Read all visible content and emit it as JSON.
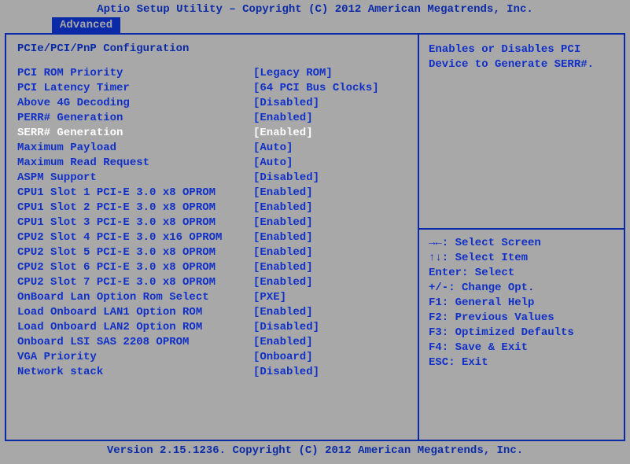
{
  "header": "Aptio Setup Utility – Copyright (C) 2012 American Megatrends, Inc.",
  "tab": "Advanced",
  "section_title": "PCIe/PCI/PnP Configuration",
  "settings": [
    {
      "label": "PCI ROM Priority",
      "value": "[Legacy ROM]",
      "selected": false
    },
    {
      "label": "PCI Latency Timer",
      "value": "[64 PCI Bus Clocks]",
      "selected": false
    },
    {
      "label": "Above 4G Decoding",
      "value": "[Disabled]",
      "selected": false
    },
    {
      "label": "PERR# Generation",
      "value": "[Enabled]",
      "selected": false
    },
    {
      "label": "SERR# Generation",
      "value": "[Enabled]",
      "selected": true
    },
    {
      "label": "Maximum Payload",
      "value": "[Auto]",
      "selected": false
    },
    {
      "label": "Maximum Read Request",
      "value": "[Auto]",
      "selected": false
    },
    {
      "label": "ASPM Support",
      "value": "[Disabled]",
      "selected": false
    },
    {
      "label": "CPU1 Slot 1 PCI-E 3.0 x8 OPROM",
      "value": "[Enabled]",
      "selected": false
    },
    {
      "label": "CPU1 Slot 2 PCI-E 3.0 x8 OPROM",
      "value": "[Enabled]",
      "selected": false
    },
    {
      "label": "CPU1 Slot 3 PCI-E 3.0 x8 OPROM",
      "value": "[Enabled]",
      "selected": false
    },
    {
      "label": "CPU2 Slot 4 PCI-E 3.0 x16 OPROM",
      "value": "[Enabled]",
      "selected": false
    },
    {
      "label": "CPU2 Slot 5 PCI-E 3.0 x8 OPROM",
      "value": "[Enabled]",
      "selected": false
    },
    {
      "label": "CPU2 Slot 6 PCI-E 3.0 x8 OPROM",
      "value": "[Enabled]",
      "selected": false
    },
    {
      "label": "CPU2 Slot 7 PCI-E 3.0 x8 OPROM",
      "value": "[Enabled]",
      "selected": false
    },
    {
      "label": "OnBoard Lan Option Rom Select",
      "value": "[PXE]",
      "selected": false
    },
    {
      "label": "Load Onboard LAN1 Option ROM",
      "value": "[Enabled]",
      "selected": false
    },
    {
      "label": "Load Onboard LAN2 Option ROM",
      "value": "[Disabled]",
      "selected": false
    },
    {
      "label": "Onboard LSI SAS 2208 OPROM",
      "value": "[Enabled]",
      "selected": false
    },
    {
      "label": "VGA Priority",
      "value": "[Onboard]",
      "selected": false
    },
    {
      "label": "Network stack",
      "value": "[Disabled]",
      "selected": false
    }
  ],
  "help_text": "Enables or Disables PCI Device to Generate SERR#.",
  "legend": [
    "→←: Select Screen",
    "↑↓: Select Item",
    "Enter: Select",
    "+/-: Change Opt.",
    "F1: General Help",
    "F2: Previous Values",
    "F3: Optimized Defaults",
    "F4: Save & Exit",
    "ESC: Exit"
  ],
  "footer": "Version 2.15.1236. Copyright (C) 2012 American Megatrends, Inc."
}
